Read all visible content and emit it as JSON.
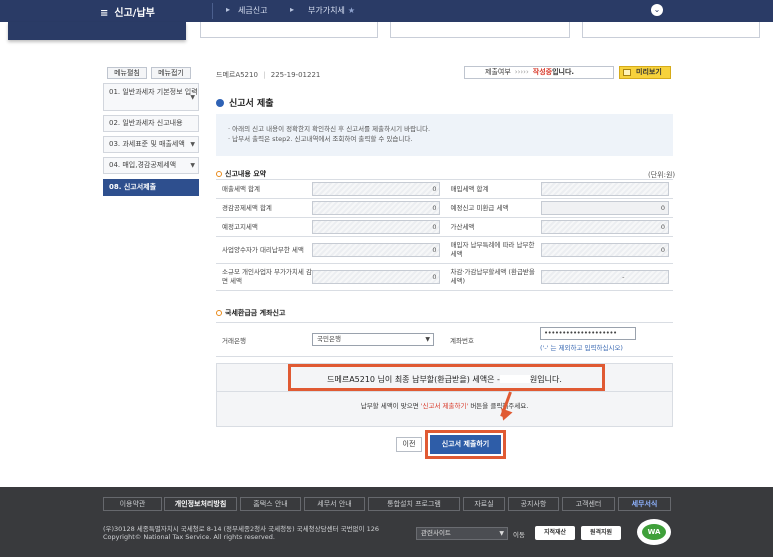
{
  "topbar": {
    "menu_label": "신고/납부",
    "menu_icon": "hamburger-icon",
    "crumb1": "세금신고",
    "crumb2": "부가가치세",
    "star": "★"
  },
  "left_menu": {
    "edit_label": "메뉴펼침",
    "collapse_label": "메뉴접기",
    "items": [
      {
        "label": "01. 일반과세자 기본정보 입력"
      },
      {
        "label": "02. 일반과세자 신고내용"
      },
      {
        "label": "03. 과세표준 및 매출세액"
      },
      {
        "label": "04. 매입,경감공제세액"
      },
      {
        "label": "08. 신고서제출"
      }
    ]
  },
  "header": {
    "biz_name": "드메르A5210",
    "biz_sep": "|",
    "biz_no": "225-19-01221",
    "status_label": "제출여부",
    "status_dots": "›››››",
    "status_value": "작성중",
    "status_suffix": "입니다.",
    "preview_label": "미리보기"
  },
  "section_title": "신고서 제출",
  "notice": {
    "line1": "· 아래의 신고 내용이 정확한지 확인하신 후 신고서를 제출하시기 바랍니다.",
    "line2": "· 납부서 출력은 step2. 신고내역에서 조회하여 출력할 수 있습니다."
  },
  "summary": {
    "title": "신고내용 요약",
    "unit": "(단위:원)",
    "rows": [
      {
        "l1": "매출세액 합계",
        "v1": "0",
        "l2": "매입세액 합계",
        "v2": ""
      },
      {
        "l1": "경감공제세액 합계",
        "v1": "0",
        "l2": "예정신고 미환급 세액",
        "v2": "0"
      },
      {
        "l1": "예정고지세액",
        "v1": "0",
        "l2": "가산세액",
        "v2": "0"
      },
      {
        "l1": "사업양수자가 대리납부한 세액",
        "v1": "0",
        "l2": "매입자 납부특례에 따라 납부한 세액",
        "v2": "0"
      },
      {
        "l1": "소규모 개인사업자 부가가치세 감면 세액",
        "v1": "0",
        "l2": "차감·가감납부할세액 (환급받을세액)",
        "v2": "-"
      }
    ]
  },
  "refund": {
    "title": "국세환급금 계좌신고",
    "bank_label": "거래은행",
    "bank_value": "국민은행",
    "account_label": "계좌번호",
    "account_value": "••••••••••••••••••••",
    "account_hint": "('-' 는 제외하고 입력하십시오)"
  },
  "result": {
    "line1_prefix": "드메르A5210 님이 최종 납부할(환급받을) 세액은 -",
    "line1_suffix": "원입니다.",
    "line2_prefix": "납부할 세액이 맞으면",
    "line2_red": "'신고서 제출하기'",
    "line2_suffix": "버튼을 클릭해주세요."
  },
  "buttons": {
    "prev": "이전",
    "submit": "신고서 제출하기"
  },
  "footer": {
    "nav": [
      "이용약관",
      "개인정보처리방침",
      "홈택스 안내",
      "세무서 안내",
      "통합설치 프로그램",
      "자료실",
      "공지사항",
      "고객센터",
      "세무서식"
    ],
    "addr1": "(우)30128 세종특별자치시 국세청로 8-14 (정부세종2청사 국세청동) 국세청상담센터 국번없이 126",
    "addr2": "Copyright© National Tax Service. All rights reserved.",
    "related_sites": "관련사이트",
    "go": "이동",
    "badge1": "지적재산",
    "badge2": "원격지원",
    "wa_mark": "WA"
  }
}
